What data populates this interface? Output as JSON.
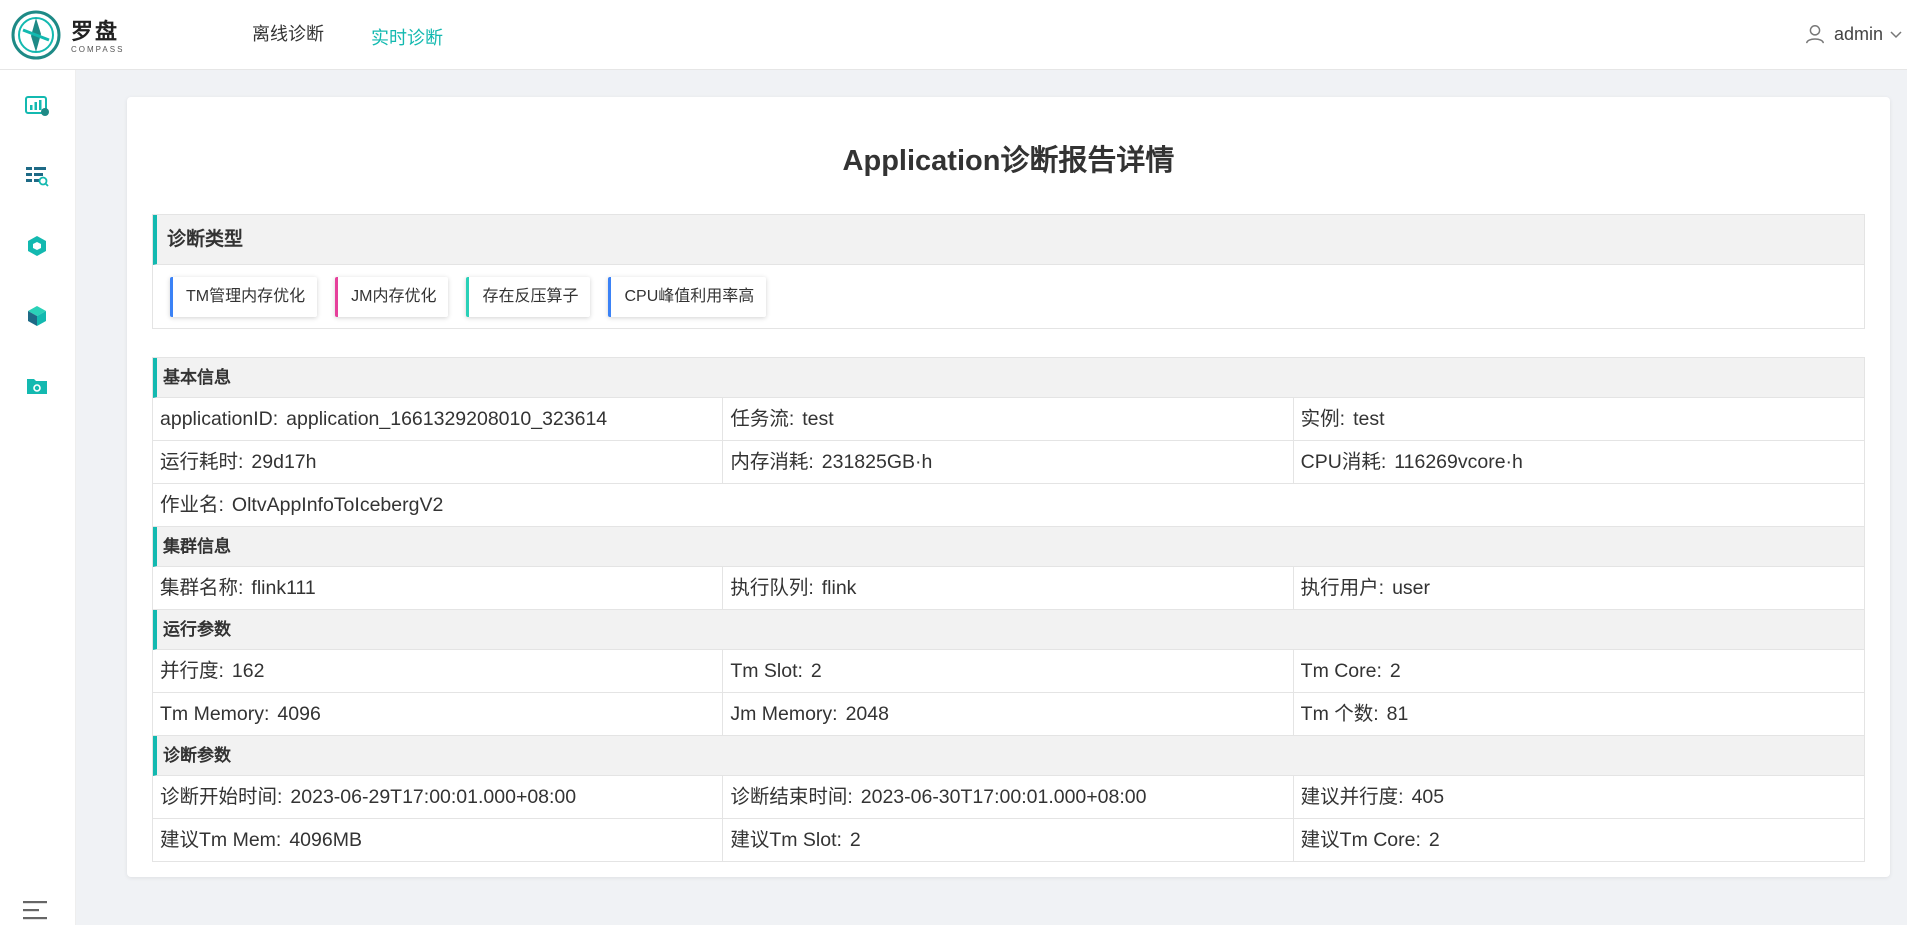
{
  "brand": {
    "name": "罗盘",
    "sub": "COMPASS"
  },
  "nav": {
    "offline": "离线诊断",
    "realtime": "实时诊断"
  },
  "user": {
    "name": "admin"
  },
  "sidebar": [
    "dashboard-icon",
    "list-search-icon",
    "hexagon-icon",
    "cube-icon",
    "folder-icon"
  ],
  "colors": {
    "accent": "#13b9b0",
    "tag_blue": "#3b82f6",
    "tag_pink": "#e6409b",
    "tag_teal": "#2ad1b8"
  },
  "title": "Application诊断报告详情",
  "diag": {
    "title": "诊断类型",
    "tags": [
      "TM管理内存优化",
      "JM内存优化",
      "存在反压算子",
      "CPU峰值利用率高"
    ]
  },
  "basic": {
    "title": "基本信息",
    "app_id_label": "applicationID:",
    "app_id": "application_1661329208010_323614",
    "flow_label": "任务流:",
    "flow": "test",
    "instance_label": "实例:",
    "instance": "test",
    "duration_label": "运行耗时:",
    "duration": "29d17h",
    "mem_label": "内存消耗:",
    "mem": "231825GB·h",
    "cpu_label": "CPU消耗:",
    "cpu": "116269vcore·h",
    "job_label": "作业名:",
    "job": "OltvAppInfoToIcebergV2"
  },
  "cluster": {
    "title": "集群信息",
    "name_label": "集群名称:",
    "name": "flink111",
    "queue_label": "执行队列:",
    "queue": "flink",
    "user_label": "执行用户:",
    "user": "user"
  },
  "runtime": {
    "title": "运行参数",
    "parallel_label": "并行度:",
    "parallel": "162",
    "slot_label": "Tm Slot:",
    "slot": "2",
    "core_label": "Tm Core:",
    "core": "2",
    "tm_mem_label": "Tm Memory:",
    "tm_mem": "4096",
    "jm_mem_label": "Jm Memory:",
    "jm_mem": "2048",
    "tm_count_label": "Tm 个数:",
    "tm_count": "81"
  },
  "diagparams": {
    "title": "诊断参数",
    "start_label": "诊断开始时间:",
    "start": "2023-06-29T17:00:01.000+08:00",
    "end_label": "诊断结束时间:",
    "end": "2023-06-30T17:00:01.000+08:00",
    "sugg_parallel_label": "建议并行度:",
    "sugg_parallel": "405",
    "sugg_mem_label": "建议Tm Mem:",
    "sugg_mem": "4096MB",
    "sugg_slot_label": "建议Tm Slot:",
    "sugg_slot": "2",
    "sugg_core_label": "建议Tm Core:",
    "sugg_core": "2"
  }
}
